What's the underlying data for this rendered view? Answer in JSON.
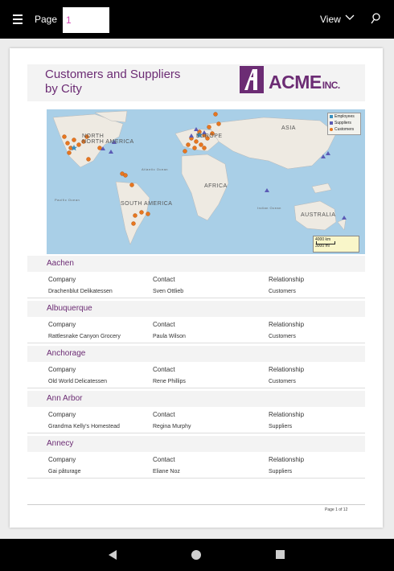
{
  "toolbar": {
    "page_label": "Page",
    "page_value": "1",
    "view_label": "View"
  },
  "report": {
    "title_line1": "Customers and Suppliers",
    "title_line2": "by City",
    "logo_text": "ACME",
    "logo_suffix": "INC.",
    "brand_color": "#6c2c74"
  },
  "map": {
    "labels": {
      "north_america": "NORTH AMERICA",
      "south_america": "SOUTH AMERICA",
      "europe": "EUROPE",
      "asia": "ASIA",
      "africa": "AFRICA",
      "australia": "AUSTRALIA",
      "atlantic_ocean": "Atlantic Ocean",
      "indian_ocean": "Indian Ocean",
      "pacific_ocean": "Pacific Ocean"
    },
    "legend": [
      {
        "label": "Employees",
        "symbol": "star",
        "color": "#3a8fbf"
      },
      {
        "label": "Suppliers",
        "symbol": "triangle",
        "color": "#5b5bb5"
      },
      {
        "label": "Customers",
        "symbol": "circle",
        "color": "#e8761f"
      }
    ],
    "scale": {
      "km": "4000 km",
      "mi": "3000 mi"
    }
  },
  "columns": {
    "company": "Company",
    "contact": "Contact",
    "relationship": "Relationship"
  },
  "groups": [
    {
      "city": "Aachen",
      "rows": [
        {
          "company": "Drachenblut Delikatessen",
          "contact": "Sven Ottlieb",
          "relationship": "Customers"
        }
      ]
    },
    {
      "city": "Albuquerque",
      "rows": [
        {
          "company": "Rattlesnake Canyon Grocery",
          "contact": "Paula Wilson",
          "relationship": "Customers"
        }
      ]
    },
    {
      "city": "Anchorage",
      "rows": [
        {
          "company": "Old World Delicatessen",
          "contact": "Rene Phillips",
          "relationship": "Customers"
        }
      ]
    },
    {
      "city": "Ann Arbor",
      "rows": [
        {
          "company": "Grandma Kelly's Homestead",
          "contact": "Regina Murphy",
          "relationship": "Suppliers"
        }
      ]
    },
    {
      "city": "Annecy",
      "rows": [
        {
          "company": "Gai pâturage",
          "contact": "Eliane Noz",
          "relationship": "Suppliers"
        }
      ]
    }
  ],
  "footer": {
    "page_text": "Page 1 of 12"
  }
}
